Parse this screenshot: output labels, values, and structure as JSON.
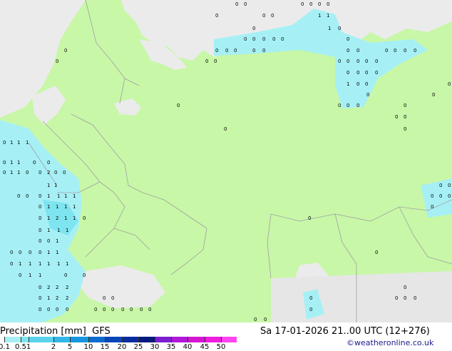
{
  "legend": {
    "title": "Precipitation [mm]",
    "model": "GFS",
    "datetime": "Sa 17-01-2026 21..00 UTC (12+276)",
    "credit": "©weatheronline.co.uk",
    "scale_labels": [
      "0.1",
      "0.5",
      "1",
      "2",
      "5",
      "10",
      "15",
      "20",
      "25",
      "30",
      "35",
      "40",
      "45",
      "50"
    ],
    "scale_colors": [
      "#a6f0f5",
      "#7ee4f0",
      "#5bd2ec",
      "#34b7e6",
      "#1696de",
      "#0b6ccf",
      "#0846b8",
      "#062c9e",
      "#071a80",
      "#7d1fd0",
      "#b018d8",
      "#d416d4",
      "#f01ce0",
      "#ff44f0"
    ]
  },
  "map_colors": {
    "land": "#c8f7a8",
    "sea": "#ebebeb",
    "dry": "#e6e6e6",
    "rain": "#a6f0f5",
    "rain_moderate": "#7ee4f0",
    "border": "#a0a0a0"
  }
}
